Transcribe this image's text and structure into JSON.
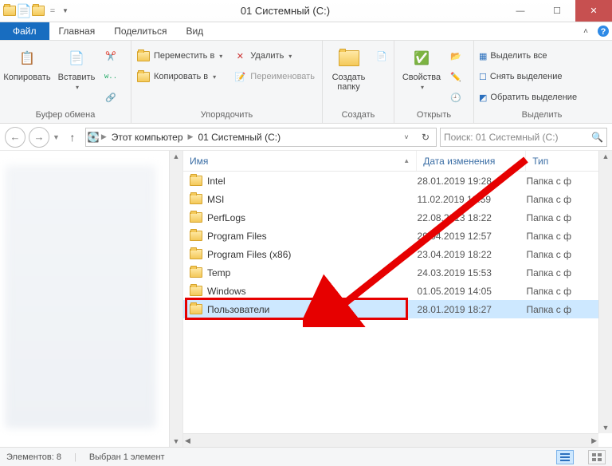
{
  "title": "01 Системный (C:)",
  "menubar": {
    "file": "Файл",
    "main": "Главная",
    "share": "Поделиться",
    "view": "Вид"
  },
  "ribbon": {
    "clipboard": {
      "label": "Буфер обмена",
      "copy": "Копировать",
      "paste": "Вставить"
    },
    "organize": {
      "label": "Упорядочить",
      "move": "Переместить в",
      "copy": "Копировать в",
      "delete": "Удалить",
      "rename": "Переименовать"
    },
    "create": {
      "label": "Создать",
      "newfolder": "Создать\nпапку"
    },
    "open": {
      "label": "Открыть",
      "properties": "Свойства"
    },
    "select": {
      "label": "Выделить",
      "all": "Выделить все",
      "none": "Снять выделение",
      "invert": "Обратить выделение"
    }
  },
  "breadcrumb": {
    "root": "Этот компьютер",
    "drive": "01 Системный (C:)"
  },
  "search": {
    "placeholder": "Поиск: 01 Системный (C:)"
  },
  "columns": {
    "name": "Имя",
    "date": "Дата изменения",
    "type": "Тип"
  },
  "files": [
    {
      "name": "Intel",
      "date": "28.01.2019 19:28",
      "type": "Папка с ф"
    },
    {
      "name": "MSI",
      "date": "11.02.2019 18:59",
      "type": "Папка с ф"
    },
    {
      "name": "PerfLogs",
      "date": "22.08.2013 18:22",
      "type": "Папка с ф"
    },
    {
      "name": "Program Files",
      "date": "29.04.2019 12:57",
      "type": "Папка с ф"
    },
    {
      "name": "Program Files (x86)",
      "date": "23.04.2019 18:22",
      "type": "Папка с ф"
    },
    {
      "name": "Temp",
      "date": "24.03.2019 15:53",
      "type": "Папка с ф"
    },
    {
      "name": "Windows",
      "date": "01.05.2019 14:05",
      "type": "Папка с ф"
    },
    {
      "name": "Пользователи",
      "date": "28.01.2019 18:27",
      "type": "Папка с ф",
      "selected": true
    }
  ],
  "status": {
    "count": "Элементов: 8",
    "selected": "Выбран 1 элемент"
  }
}
